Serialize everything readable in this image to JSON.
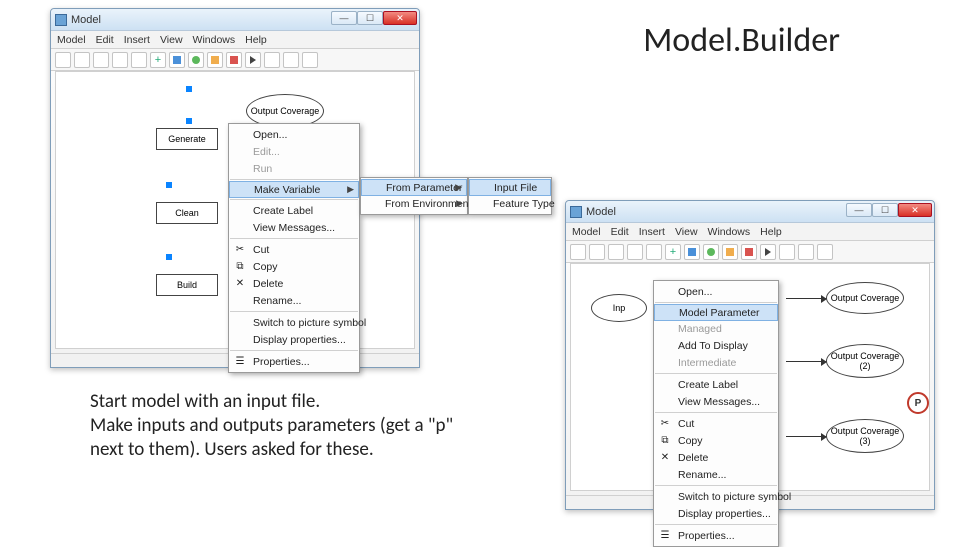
{
  "slide": {
    "title": "Model.Builder",
    "caption_l1": "Start model with an input file.",
    "caption_l2": "Make inputs and outputs parameters (get a \"p\" next to them). Users asked for these."
  },
  "win": {
    "title": "Model",
    "menu": [
      "Model",
      "Edit",
      "Insert",
      "View",
      "Windows",
      "Help"
    ]
  },
  "nodes": {
    "output_cov": "Output Coverage",
    "generate": "Generate",
    "clean": "Clean",
    "build": "Build",
    "inp": "Inp",
    "out1": "Output Coverage",
    "out2": "Output Coverage (2)",
    "out3": "Output Coverage (3)",
    "p": "P"
  },
  "ctx1": {
    "items": [
      "Open...",
      "Edit...",
      "Run",
      "Make Variable",
      "Create Label",
      "View Messages...",
      "Cut",
      "Copy",
      "Delete",
      "Rename...",
      "Switch to picture symbol",
      "Display properties...",
      "Properties..."
    ],
    "highlighted": "Make Variable",
    "sub1": [
      "From Parameter",
      "From Environment"
    ],
    "sub2": [
      "Input File",
      "Feature Type"
    ]
  },
  "ctx2": {
    "items": [
      "Open...",
      "Model Parameter",
      "Managed",
      "Add To Display",
      "Intermediate",
      "Create Label",
      "View Messages...",
      "Cut",
      "Copy",
      "Delete",
      "Rename...",
      "Switch to picture symbol",
      "Display properties...",
      "Properties..."
    ],
    "highlighted": "Model Parameter"
  }
}
